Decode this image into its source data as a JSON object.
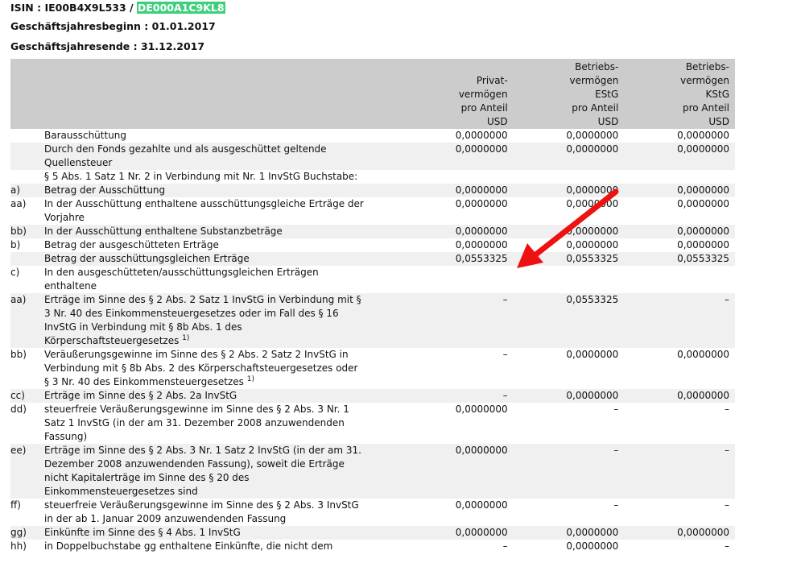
{
  "header": {
    "isin_label": "ISIN : IE00B4X9L533 / ",
    "isin_highlight": "DE000A1C9KL8",
    "start": "Geschäftsjahresbeginn : 01.01.2017",
    "end": "Geschäftsjahresende : 31.12.2017",
    "highlight_color": "#3ecf7c"
  },
  "columns": [
    "Privat-\nvermögen\npro Anteil\nUSD",
    "Betriebs-\nvermögen\nEStG\npro Anteil\nUSD",
    "Betriebs-\nvermögen\nKStG\npro Anteil\nUSD"
  ],
  "rows": [
    {
      "label": "",
      "desc": "Barausschüttung",
      "v": [
        "0,0000000",
        "0,0000000",
        "0,0000000"
      ]
    },
    {
      "label": "",
      "desc": "Durch den Fonds gezahlte und als ausgeschüttet geltende\nQuellensteuer",
      "v": [
        "0,0000000",
        "0,0000000",
        "0,0000000"
      ]
    },
    {
      "label": "",
      "desc": "§ 5 Abs. 1 Satz 1 Nr. 2 in Verbindung mit Nr. 1 InvStG Buchstabe:",
      "v": [
        "",
        "",
        ""
      ]
    },
    {
      "label": "a)",
      "desc": "Betrag der Ausschüttung",
      "v": [
        "0,0000000",
        "0,0000000",
        "0,0000000"
      ]
    },
    {
      "label": "aa)",
      "desc": "In der Ausschüttung enthaltene ausschüttungsgleiche Erträge der\nVorjahre",
      "v": [
        "0,0000000",
        "0,0000000",
        "0,0000000"
      ]
    },
    {
      "label": "bb)",
      "desc": "In der Ausschüttung enthaltene Substanzbeträge",
      "v": [
        "0,0000000",
        "0,0000000",
        "0,0000000"
      ]
    },
    {
      "label": "b)",
      "desc": "Betrag der ausgeschütteten Erträge",
      "v": [
        "0,0000000",
        "0,0000000",
        "0,0000000"
      ]
    },
    {
      "label": "",
      "desc": "Betrag der ausschüttungsgleichen Erträge",
      "v": [
        "0,0553325",
        "0,0553325",
        "0,0553325"
      ]
    },
    {
      "label": "c)",
      "desc": "In den ausgeschütteten/ausschüttungsgleichen Erträgen\nenthaltene",
      "v": [
        "",
        "",
        ""
      ]
    },
    {
      "label": "aa)",
      "desc": "Erträge im Sinne des § 2 Abs. 2 Satz 1 InvStG in Verbindung mit §\n3 Nr. 40 des Einkommensteuergesetzes oder im Fall des § 16\nInvStG in Verbindung mit § 8b Abs. 1 des\nKörperschaftsteuergesetzes",
      "note": "1)",
      "v": [
        "–",
        "0,0553325",
        "–"
      ]
    },
    {
      "label": "bb)",
      "desc": "Veräußerungsgewinne im Sinne des § 2 Abs. 2 Satz 2 InvStG in\nVerbindung mit § 8b Abs. 2 des Körperschaftsteuergesetzes oder\n§ 3 Nr. 40 des Einkommensteuergesetzes",
      "note": "1)",
      "v": [
        "–",
        "0,0000000",
        "0,0000000"
      ]
    },
    {
      "label": "cc)",
      "desc": "Erträge im Sinne des § 2 Abs. 2a InvStG",
      "v": [
        "–",
        "0,0000000",
        "0,0000000"
      ]
    },
    {
      "label": "dd)",
      "desc": "steuerfreie Veräußerungsgewinne im Sinne des § 2 Abs. 3 Nr. 1\nSatz 1 InvStG (in der am 31. Dezember 2008 anzuwendenden\nFassung)",
      "v": [
        "0,0000000",
        "–",
        "–"
      ]
    },
    {
      "label": "ee)",
      "desc": "Erträge im Sinne des § 2 Abs. 3 Nr. 1 Satz 2 InvStG (in der am 31.\nDezember 2008 anzuwendenden Fassung), soweit die Erträge\nnicht Kapitalerträge im Sinne des § 20 des\nEinkommensteuergesetzes sind",
      "v": [
        "0,0000000",
        "–",
        "–"
      ]
    },
    {
      "label": "ff)",
      "desc": "steuerfreie Veräußerungsgewinne im Sinne des § 2 Abs. 3 InvStG\nin der ab 1. Januar 2009 anzuwendenden Fassung",
      "v": [
        "0,0000000",
        "–",
        "–"
      ]
    },
    {
      "label": "gg)",
      "desc": "Einkünfte im Sinne des § 4 Abs. 1 InvStG",
      "v": [
        "0,0000000",
        "0,0000000",
        "0,0000000"
      ]
    },
    {
      "label": "hh)",
      "desc": "in Doppelbuchstabe gg enthaltene Einkünfte, die nicht dem",
      "v": [
        "–",
        "0,0000000",
        "–"
      ]
    }
  ],
  "annotation": {
    "arrow_color": "#ee1111"
  }
}
